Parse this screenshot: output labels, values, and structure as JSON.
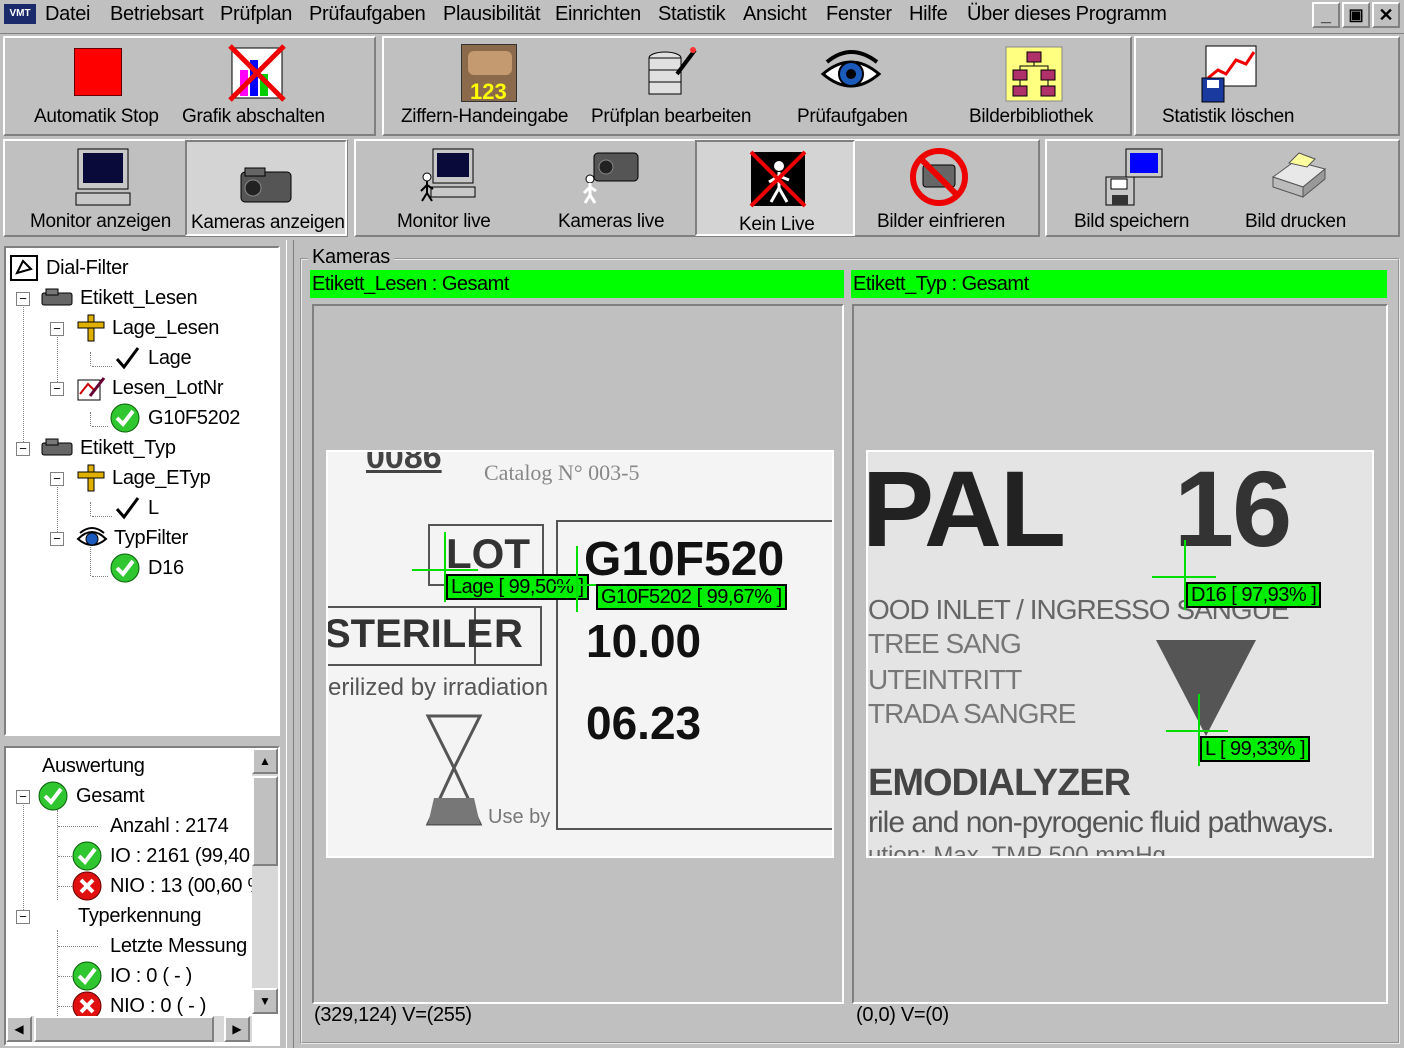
{
  "app": {
    "icon_label": "VMT"
  },
  "menu": [
    "Datei",
    "Betriebsart",
    "Prüfplan",
    "Prüfaufgaben",
    "Plausibilität",
    "Einrichten",
    "Statistik",
    "Ansicht",
    "Fenster",
    "Hilfe",
    "Über dieses Programm"
  ],
  "window_controls": {
    "minimize": "_",
    "restore": "▣",
    "close": "✕"
  },
  "toolbar1": {
    "automatik_stop": "Automatik Stop",
    "grafik_abschalten": "Grafik abschalten",
    "ziffern_handeingabe": "Ziffern-Handeingabe",
    "pruefplan_bearbeiten": "Prüfplan bearbeiten",
    "pruefaufgaben": "Prüfaufgaben",
    "bilderbibliothek": "Bilderbibliothek",
    "statistik_loeschen": "Statistik löschen",
    "ziffern_icon_text": "123"
  },
  "toolbar2": {
    "monitor_anzeigen": "Monitor anzeigen",
    "kameras_anzeigen": "Kameras anzeigen",
    "monitor_live": "Monitor live",
    "kameras_live": "Kameras live",
    "kein_live": "Kein Live",
    "bilder_einfrieren": "Bilder einfrieren",
    "bild_speichern": "Bild speichern",
    "bild_drucken": "Bild drucken"
  },
  "tree": {
    "root": "Dial-Filter",
    "etikett_lesen": "Etikett_Lesen",
    "lage_lesen": "Lage_Lesen",
    "lage": "Lage",
    "lesen_lotnr": "Lesen_LotNr",
    "g10f5202": "G10F5202",
    "etikett_typ": "Etikett_Typ",
    "lage_etyp": "Lage_ETyp",
    "l": "L",
    "typfilter": "TypFilter",
    "d16": "D16"
  },
  "auswertung": {
    "title": "Auswertung",
    "gesamt": "Gesamt",
    "anzahl": "Anzahl : 2174",
    "io": "IO  : 2161 (99,40",
    "nio": "NIO : 13 (00,60 %",
    "typerkennung": "Typerkennung",
    "letzte_messung": "Letzte Messung",
    "io2": "IO :  0 ( - )",
    "nio2": "NIO :  0 ( - )"
  },
  "kameras": {
    "group_title": "Kameras",
    "cam1": {
      "header": "Etikett_Lesen : Gesamt",
      "status": "(329,124)  V=(255)",
      "label_lage": "Lage [ 99,50% ]",
      "label_lot": "G10F5202 [ 99,67% ]",
      "img": {
        "top": "0086",
        "catalog": "Catalog N° 003-5",
        "lot": "LOT",
        "code": "G10F520",
        "sterile": "STERILE",
        "r": "R",
        "irr": "erilized by irradiation",
        "val1": "10.00",
        "val2": "06.23",
        "useby": "Use by"
      }
    },
    "cam2": {
      "header": "Etikett_Typ : Gesamt",
      "status": "(0,0)  V=(0)",
      "label_d16": "D16 [ 97,93% ]",
      "label_l": "L [ 99,33% ]",
      "img": {
        "pal": "PAL",
        "num": "16",
        "l1": "OOD INLET / INGRESSO SANGUE",
        "l2": "TREE SANG",
        "l3": "UTEINTRITT",
        "l4": "TRADA SANGRE",
        "l5": "EMODIALYZER",
        "l6": "rile and non-pyrogenic fluid pathways.",
        "l7": "ution: Max. TMP 500 mmHg"
      }
    }
  },
  "colors": {
    "face": "#c0c0c0",
    "status_ok": "#00ff00",
    "accent_red": "#ff0000"
  }
}
